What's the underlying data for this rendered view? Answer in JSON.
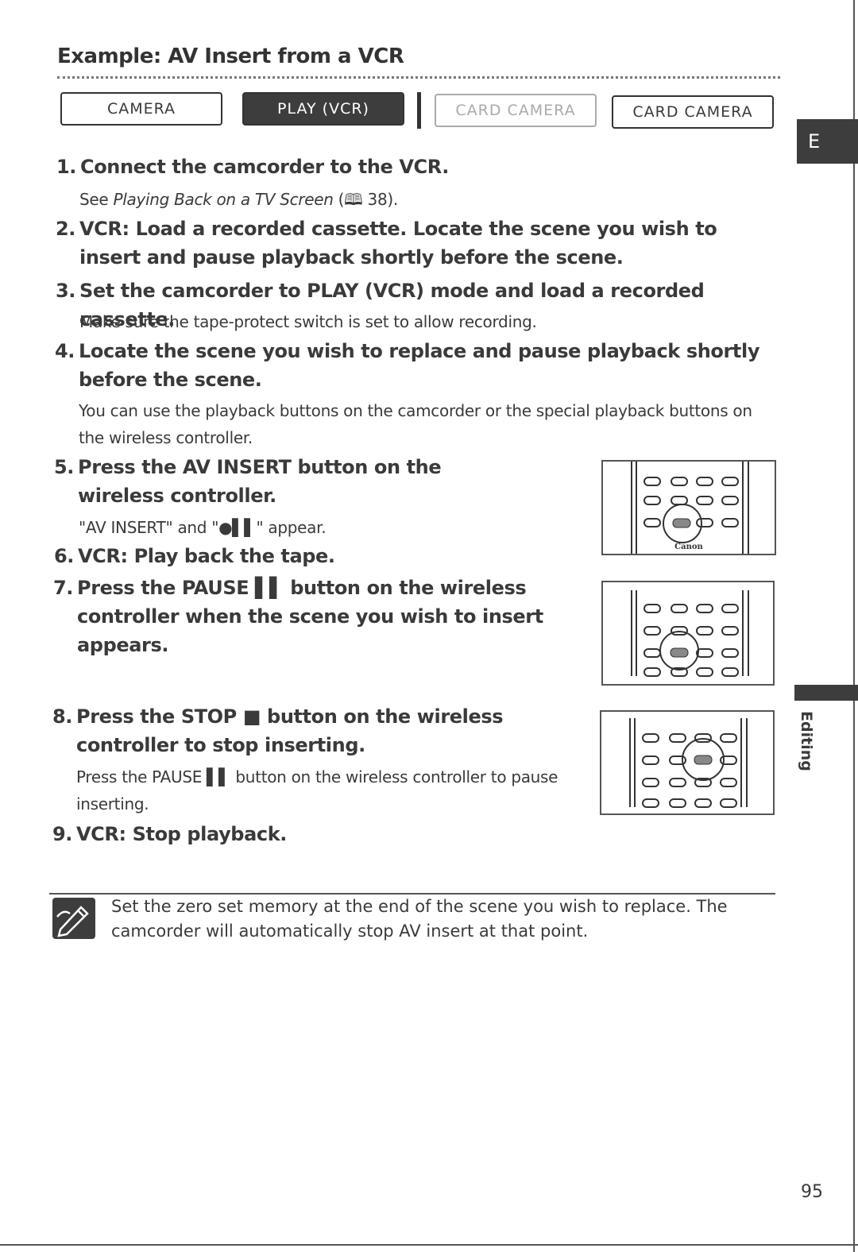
{
  "title": "Example: AV Insert from a VCR",
  "modes": [
    {
      "label": "CAMERA",
      "state": "normal"
    },
    {
      "label": "PLAY (VCR)",
      "state": "active"
    },
    {
      "label": "CARD CAMERA",
      "state": "dimmed"
    },
    {
      "label": "CARD CAMERA",
      "state": "normal"
    }
  ],
  "side_tab": {
    "letter": "E",
    "section": "Editing"
  },
  "steps": [
    {
      "num": "1.",
      "text": "Connect the camcorder to the VCR.",
      "sub_pre": "See ",
      "sub_italic": "Playing Back on a TV Screen",
      "sub_post": " (🕮 38)."
    },
    {
      "num": "2.",
      "text": "VCR: Load a recorded cassette. Locate the scene you wish to insert and pause playback shortly before the scene."
    },
    {
      "num": "3.",
      "text": "Set the camcorder to PLAY (VCR) mode and load a recorded cassette.",
      "sub": "Make sure the tape-protect switch is set to allow recording."
    },
    {
      "num": "4.",
      "text": "Locate the scene you wish to replace and pause playback shortly before the scene.",
      "sub": "You can use the playback buttons on the camcorder or the special playback buttons on the wireless controller."
    },
    {
      "num": "5.",
      "text": "Press the AV INSERT button on the wireless controller.",
      "sub": "\"AV INSERT\" and \"●▌▌\" appear."
    },
    {
      "num": "6.",
      "text": "VCR: Play back the tape."
    },
    {
      "num": "7.",
      "text": "Press the PAUSE ▌▌ button on the wireless controller when the scene you wish to insert appears."
    },
    {
      "num": "8.",
      "text": "Press the STOP ■ button on the wireless controller to stop inserting.",
      "sub": "Press the PAUSE ▌▌ button on the wireless controller to pause inserting."
    },
    {
      "num": "9.",
      "text": "VCR: Stop playback."
    }
  ],
  "figures": [
    {
      "highlight": "AV INSERT",
      "brand": "Canon"
    },
    {
      "highlight": "PAUSE"
    },
    {
      "highlight": "STOP"
    }
  ],
  "note": {
    "icon": "pencil-note-icon",
    "text": "Set the zero set memory at the end of the scene you wish to replace. The camcorder will automatically stop AV insert at that point."
  },
  "page_number": "95"
}
